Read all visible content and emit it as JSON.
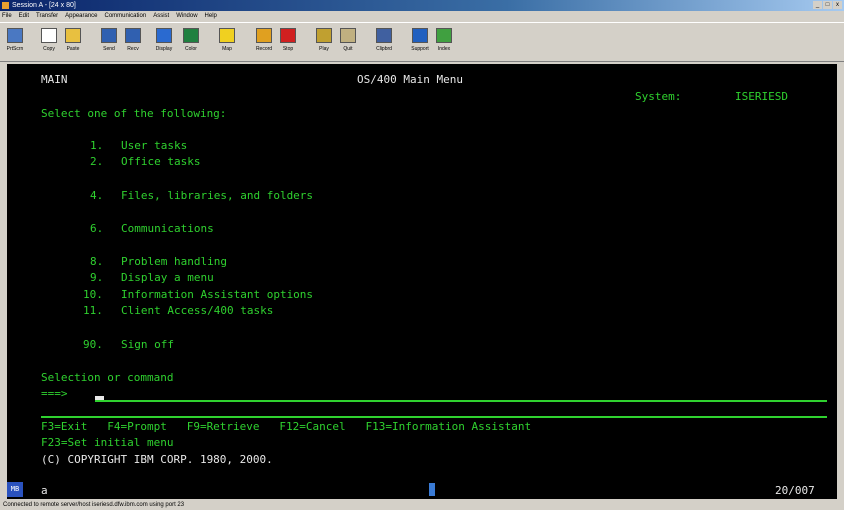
{
  "window": {
    "title": "Session A - [24 x 80]",
    "controls": [
      "_",
      "□",
      "x"
    ]
  },
  "menu": [
    "File",
    "Edit",
    "Transfer",
    "Appearance",
    "Communication",
    "Assist",
    "Window",
    "Help"
  ],
  "toolbar": [
    {
      "label": "PrtScrn",
      "icon": "print-screen-icon",
      "color": "#4a78c2"
    },
    {
      "label": "Copy",
      "icon": "copy-icon",
      "color": "#ffffff"
    },
    {
      "label": "Paste",
      "icon": "paste-icon",
      "color": "#e8c040"
    },
    {
      "label": "Send",
      "icon": "send-icon",
      "color": "#3060b0"
    },
    {
      "label": "Recv",
      "icon": "receive-icon",
      "color": "#3060b0"
    },
    {
      "label": "Display",
      "icon": "display-icon",
      "color": "#2a6ad0"
    },
    {
      "label": "Color",
      "icon": "color-icon",
      "color": "#208040"
    },
    {
      "label": "Map",
      "icon": "map-icon",
      "color": "#f0d020"
    },
    {
      "label": "Record",
      "icon": "record-icon",
      "color": "#e0a020"
    },
    {
      "label": "Stop",
      "icon": "stop-icon",
      "color": "#d02020"
    },
    {
      "label": "Play",
      "icon": "play-icon",
      "color": "#c0a030"
    },
    {
      "label": "Quit",
      "icon": "quit-icon",
      "color": "#c0b080"
    },
    {
      "label": "Clipbrd",
      "icon": "clipboard-icon",
      "color": "#4060a0"
    },
    {
      "label": "Support",
      "icon": "support-icon",
      "color": "#2060c0"
    },
    {
      "label": "Index",
      "icon": "index-icon",
      "color": "#40a040"
    }
  ],
  "terminal": {
    "screen_id": "MAIN",
    "heading": "OS/400 Main Menu",
    "system_label": "System:",
    "system_name": "ISERIESD",
    "instruction": "Select one of the following:",
    "options": [
      {
        "num": "1.",
        "label": "User tasks"
      },
      {
        "num": "2.",
        "label": "Office tasks"
      },
      {
        "num": "4.",
        "label": "Files, libraries, and folders"
      },
      {
        "num": "6.",
        "label": "Communications"
      },
      {
        "num": "8.",
        "label": "Problem handling"
      },
      {
        "num": "9.",
        "label": "Display a menu"
      },
      {
        "num": "10.",
        "label": "Information Assistant options"
      },
      {
        "num": "11.",
        "label": "Client Access/400 tasks"
      },
      {
        "num": "90.",
        "label": "Sign off"
      }
    ],
    "prompt_label": "Selection or command",
    "prompt_arrow": "===>",
    "fkeys_line1": "F3=Exit   F4=Prompt   F9=Retrieve   F12=Cancel   F13=Information Assistant",
    "fkeys_line2": "F23=Set initial menu",
    "copyright": "(C) COPYRIGHT IBM CORP. 1980, 2000."
  },
  "oia": {
    "mw_label": "MB",
    "indicator": "a",
    "cursor_position": "20/007"
  },
  "status_bar": "Connected to remote server/host iseriesd.dfw.ibm.com using port 23"
}
